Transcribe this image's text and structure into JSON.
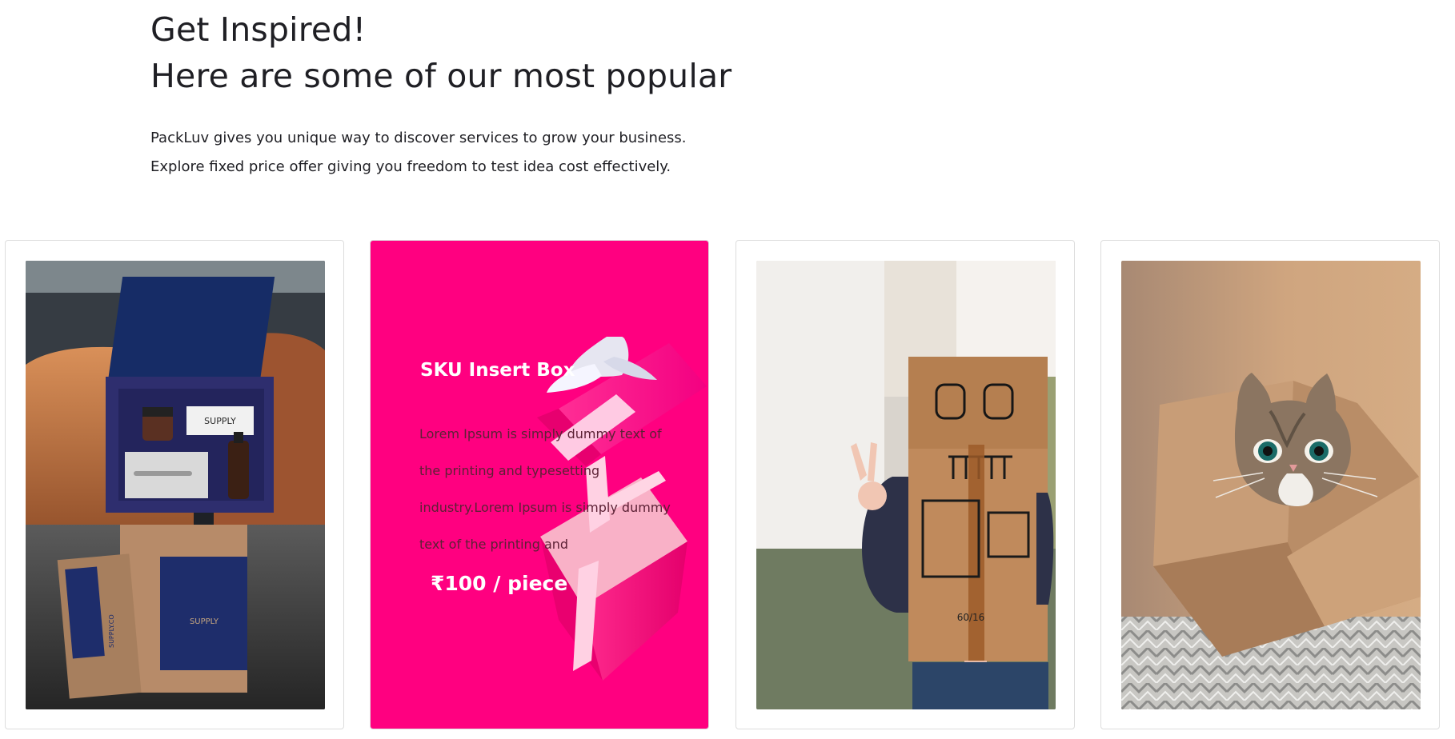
{
  "section": {
    "title_line_1": "Get Inspired!",
    "title_line_2": "Here are some of our most popular",
    "description_line_1": "PackLuv gives you unique way to discover services to grow your business.",
    "description_line_2": "Explore fixed price offer giving you freedom to test idea cost effectively."
  },
  "cards": [
    {
      "image_name": "packaging-supply-box-image",
      "image_text_1": "SUPPLY",
      "image_text_2": "SUPPLY",
      "image_text_3": "SUPPLY.CO"
    },
    {
      "title": "SKU Insert Box",
      "body": "Lorem Ipsum is simply dummy text of the printing and typesetting industry.Lorem Ipsum is simply dummy text of the printing and",
      "price": "₹100 / piece",
      "background": "#ff0080"
    },
    {
      "image_name": "child-cardboard-robot-image",
      "image_text_1": "60/16"
    },
    {
      "image_name": "cat-in-cardboard-box-image"
    }
  ]
}
